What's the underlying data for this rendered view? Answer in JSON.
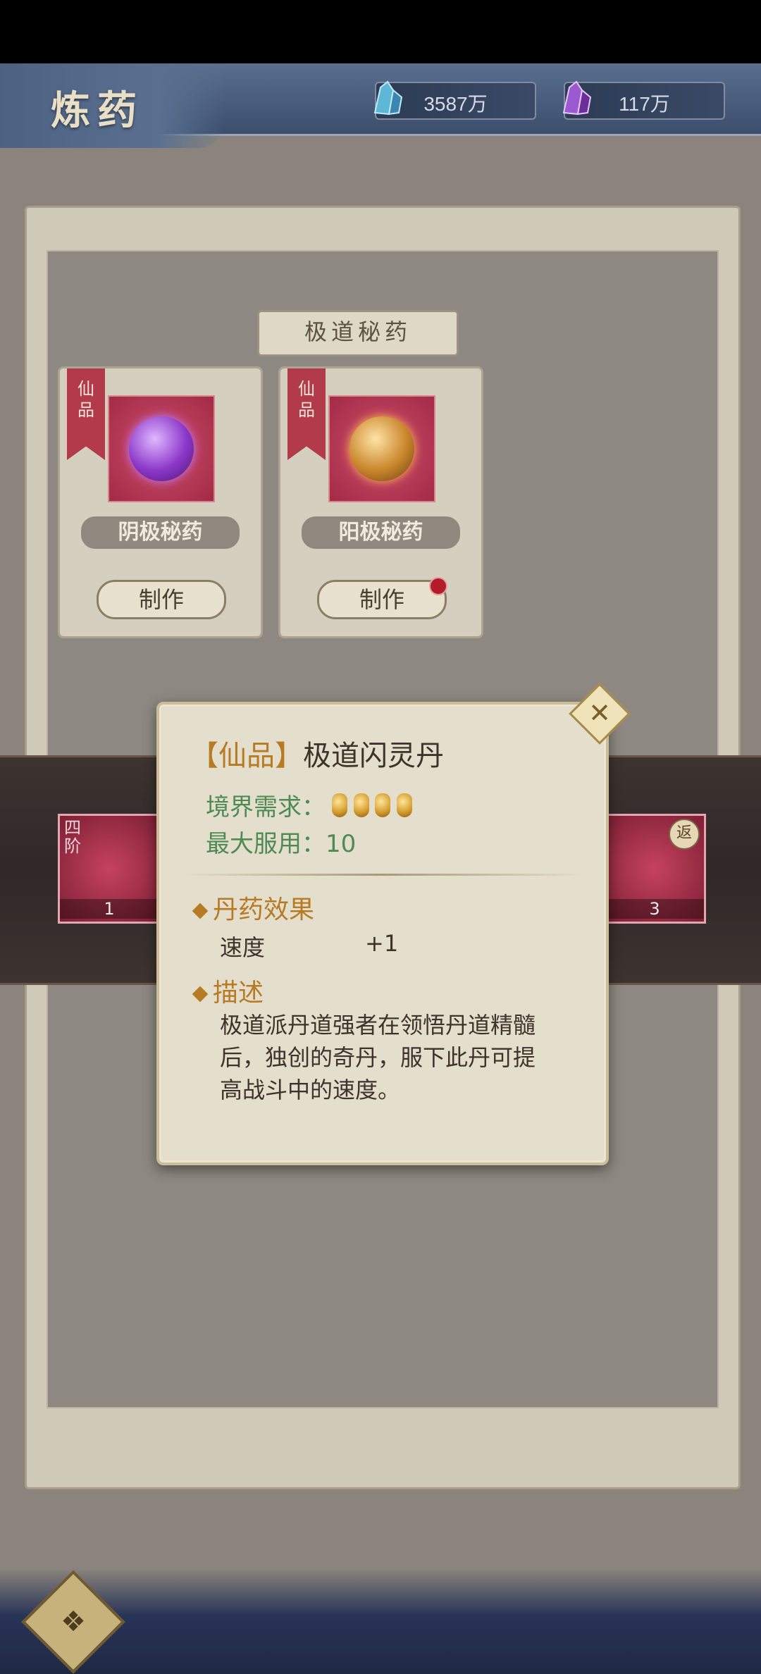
{
  "header": {
    "title": "炼药",
    "currencies": [
      {
        "icon": "blue-crystal-icon",
        "value": "3587万"
      },
      {
        "icon": "purple-crystal-icon",
        "value": "117万"
      }
    ]
  },
  "section": {
    "title": "极道秘药",
    "cards": [
      {
        "quality": "仙品",
        "name": "阴极秘药",
        "button": "制作",
        "has_dot": false
      },
      {
        "quality": "仙品",
        "name": "阳极秘药",
        "button": "制作",
        "has_dot": true
      }
    ]
  },
  "slots": [
    {
      "tier": "四阶",
      "count": "1"
    },
    {
      "return_badge": "返",
      "count": "3"
    }
  ],
  "popup": {
    "quality": "【仙品】",
    "name": "极道闪灵丹",
    "realm_label": "境界需求：",
    "max_label": "最大服用：",
    "max_value": "10",
    "effect_title": "丹药效果",
    "effect_stat": "速度",
    "effect_value": "+1",
    "desc_title": "描述",
    "desc_text": "极道派丹道强者在领悟丹道精髓后，独创的奇丹，服下此丹可提高战斗中的速度。",
    "close_icon": "close-icon"
  },
  "colors": {
    "accent_gold": "#b77a25",
    "accent_green": "#4f8a55",
    "ribbon_red": "#b33a4a"
  }
}
